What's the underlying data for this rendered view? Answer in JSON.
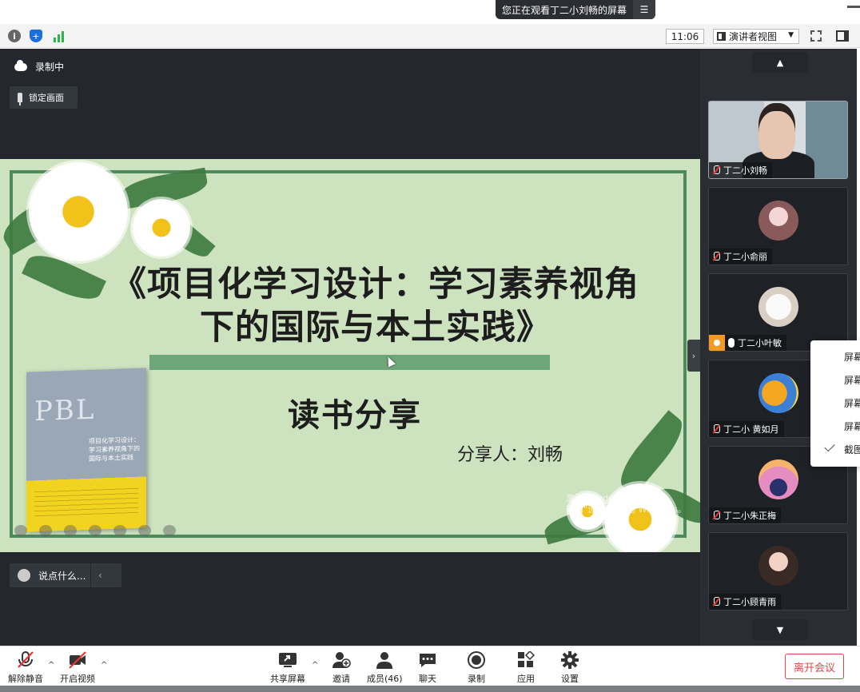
{
  "banner": {
    "text": "您正在观看丁二小刘畅的屏幕",
    "menu_icon": "list-icon"
  },
  "toolbar": {
    "time": "11:06",
    "view_mode": "演讲者视图",
    "icons": [
      "info-icon",
      "shield-icon",
      "signal-icon",
      "fullscreen-icon",
      "sidebar-toggle-icon"
    ]
  },
  "recording": {
    "label": "录制中"
  },
  "lock_view": {
    "label": "锁定画面"
  },
  "slide": {
    "title": "《项目化学习设计：学习素养视角下的国际与本土实践》",
    "subtitle": "读书分享",
    "presenter": "分享人：刘畅",
    "book_cover_text": "PBL",
    "book_title": "项目化学习设计：学习素养视角下的国际与本土实践",
    "watermark_line1": "激活 Windows",
    "watermark_line2": "转到\"设置\"以激活 Windows。"
  },
  "chat": {
    "placeholder": "说点什么..."
  },
  "gallery": {
    "participants": [
      {
        "name": "丁二小刘畅",
        "muted": true
      },
      {
        "name": "丁二小俞丽",
        "muted": true
      },
      {
        "name": "丁二小叶敏",
        "muted": false
      },
      {
        "name": "丁二小 黄如月",
        "muted": true
      },
      {
        "name": "丁二小朱正梅",
        "muted": true
      },
      {
        "name": "丁二小顾青雨",
        "muted": true
      }
    ]
  },
  "context_menu": {
    "items": [
      "屏幕",
      "屏幕",
      "屏幕",
      "屏幕",
      "截图"
    ],
    "checked_index": 4
  },
  "bottom_bar": {
    "unmute": "解除静音",
    "start_video": "开启视频",
    "share_screen": "共享屏幕",
    "invite": "邀请",
    "members": "成员(46)",
    "chat": "聊天",
    "record": "录制",
    "apps": "应用",
    "settings": "设置",
    "leave": "离开会议"
  },
  "colors": {
    "slide_bg": "#cde2bf",
    "frame": "#4f8a5f",
    "leave": "#e04848",
    "dark_bg": "#24282e"
  }
}
